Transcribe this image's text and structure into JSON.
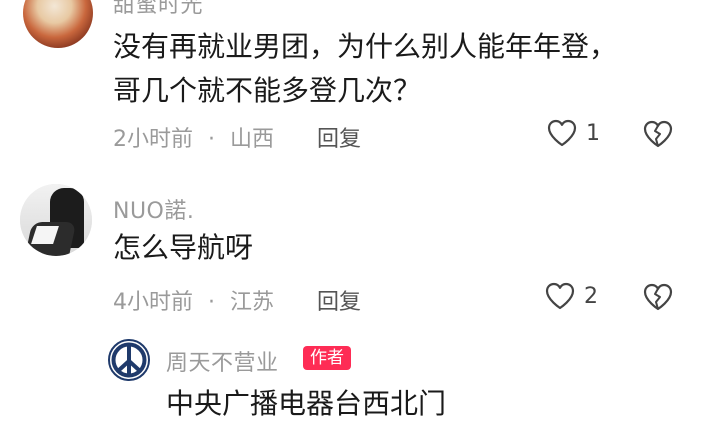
{
  "comments": [
    {
      "username": "甜蜜时光",
      "text_line1": "没有再就业男团，为什么别人能年年登，",
      "text_line2": "哥几个就不能多登几次？",
      "time": "2小时前",
      "location": "山西",
      "reply_label": "回复",
      "likes": "1"
    },
    {
      "username": "NUO諾.",
      "text_line1": "怎么导航呀",
      "time": "4小时前",
      "location": "江苏",
      "reply_label": "回复",
      "likes": "2"
    }
  ],
  "reply": {
    "username": "周天不营业",
    "badge": "作者",
    "text": "中央广播电器台西北门"
  },
  "meta_separator": "·",
  "colors": {
    "author_badge": "#fe2c55",
    "text_primary": "#1a1a1a",
    "text_secondary": "#9a9a9a"
  }
}
